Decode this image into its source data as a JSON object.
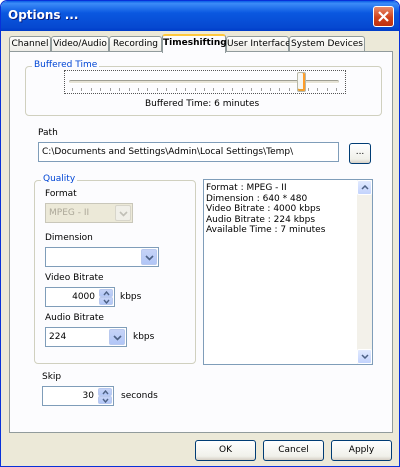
{
  "window": {
    "title": "Options ..."
  },
  "tabs": [
    {
      "label": "Channel",
      "active": false
    },
    {
      "label": "Video/Audio",
      "active": false
    },
    {
      "label": "Recording",
      "active": false
    },
    {
      "label": "Timeshifting",
      "active": true
    },
    {
      "label": "User Interface",
      "active": false
    },
    {
      "label": "System Devices",
      "active": false
    }
  ],
  "buffered": {
    "group_label": "Buffered Time",
    "status": "Buffered Time: 6 minutes",
    "slider_fraction": 0.86
  },
  "path": {
    "label": "Path",
    "value": "C:\\Documents and Settings\\Admin\\Local Settings\\Temp\\",
    "browse_label": "..."
  },
  "quality": {
    "group_label": "Quality",
    "format_label": "Format",
    "format_value": "MPEG - II",
    "dimension_label": "Dimension",
    "dimension_value": "",
    "video_bitrate_label": "Video Bitrate",
    "video_bitrate_value": "4000",
    "video_unit": "kbps",
    "audio_bitrate_label": "Audio Bitrate",
    "audio_bitrate_value": "224",
    "audio_unit": "kbps"
  },
  "info": {
    "lines": [
      "Format : MPEG - II",
      "Dimension : 640 * 480",
      "Video Bitrate : 4000 kbps",
      "Audio Bitrate : 224 kbps",
      "Available Time : 7 minutes"
    ]
  },
  "skip": {
    "label": "Skip",
    "value": "30",
    "unit": "seconds"
  },
  "buttons": {
    "ok": "OK",
    "cancel": "Cancel",
    "apply": "Apply"
  },
  "icons": {
    "close": "close-icon",
    "dropdown": "chevron-down-icon",
    "spin_up": "chevron-up-icon",
    "spin_down": "chevron-down-icon",
    "scroll_up": "chevron-up-icon",
    "scroll_down": "chevron-down-icon"
  }
}
